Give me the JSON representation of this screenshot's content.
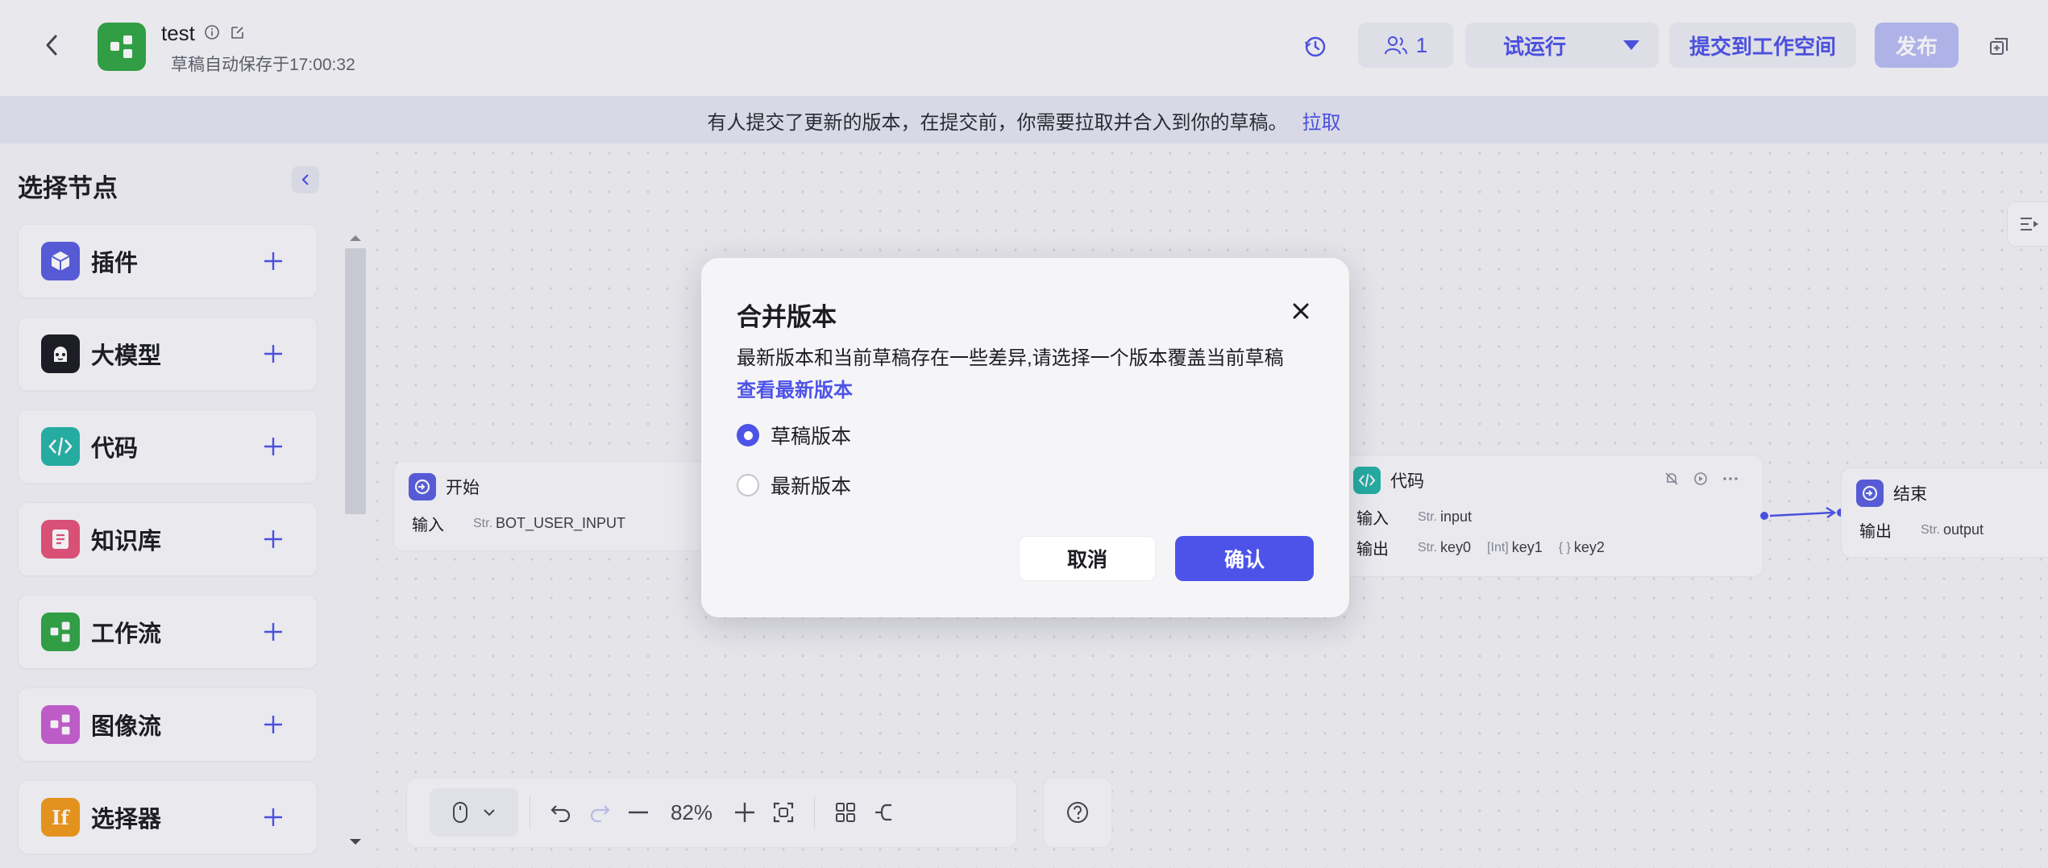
{
  "header": {
    "app_name": "test",
    "autosave_text": "草稿自动保存于17:00:32",
    "collaborators_count": "1",
    "test_run_label": "试运行",
    "submit_label": "提交到工作空间",
    "publish_label": "发布",
    "icons": [
      "back-icon",
      "workflow-icon",
      "info-icon",
      "edit-icon",
      "history-icon",
      "users-icon",
      "caret-down-icon",
      "new-window-icon"
    ]
  },
  "notice": {
    "message": "有人提交了更新的版本，在提交前，你需要拉取并合入到你的草稿。",
    "action": "拉取"
  },
  "sidebar": {
    "title": "选择节点",
    "items": [
      {
        "label": "插件",
        "icon": "plugin-icon",
        "color": "#5a5fe0"
      },
      {
        "label": "大模型",
        "icon": "llm-icon",
        "color": "#1c1d23"
      },
      {
        "label": "代码",
        "icon": "code-icon",
        "color": "#26b5a8"
      },
      {
        "label": "知识库",
        "icon": "knowledge-icon",
        "color": "#e6537a"
      },
      {
        "label": "工作流",
        "icon": "workflow-icon",
        "color": "#32a645"
      },
      {
        "label": "图像流",
        "icon": "imageflow-icon",
        "color": "#c95fd1"
      },
      {
        "label": "选择器",
        "icon": "selector-icon",
        "color": "#f09a1a"
      }
    ]
  },
  "nodes": {
    "start": {
      "title": "开始",
      "input_label": "输入",
      "input_type": "Str.",
      "input_value": "BOT_USER_INPUT"
    },
    "code": {
      "title": "代码",
      "input_label": "输入",
      "input_type": "Str.",
      "input_value": "input",
      "output_label": "输出",
      "outputs": [
        {
          "type": "Str.",
          "name": "key0"
        },
        {
          "type": "[Int]",
          "name": "key1"
        },
        {
          "type": "{ }",
          "name": "key2"
        }
      ]
    },
    "end": {
      "title": "结束",
      "output_label": "输出",
      "output_type": "Str.",
      "output_value": "output"
    }
  },
  "toolbar": {
    "zoom": "82%"
  },
  "modal": {
    "title": "合并版本",
    "description": "最新版本和当前草稿存在一些差异,请选择一个版本覆盖当前草稿",
    "link": "查看最新版本",
    "options": [
      {
        "label": "草稿版本",
        "selected": true
      },
      {
        "label": "最新版本",
        "selected": false
      }
    ],
    "cancel_label": "取消",
    "confirm_label": "确认"
  },
  "colors": {
    "accent": "#4d53e8",
    "publish_disabled": "#b9bdf4",
    "app_icon": "#32a645"
  }
}
